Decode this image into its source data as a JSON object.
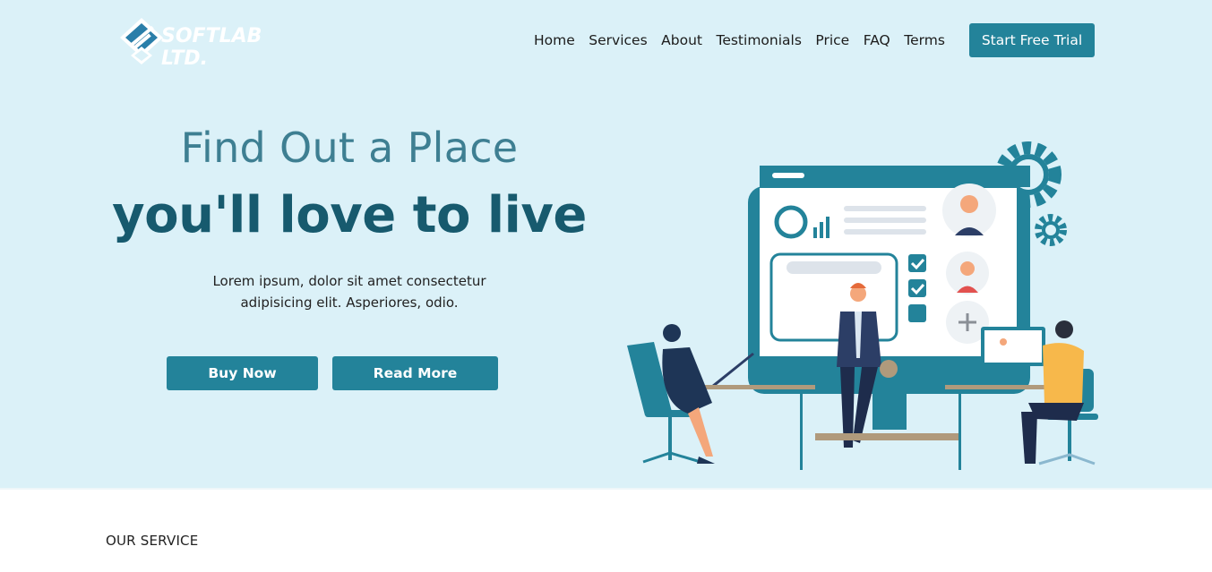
{
  "brand": {
    "name": "SOFTLAB LTD."
  },
  "nav": {
    "items": [
      {
        "label": "Home"
      },
      {
        "label": "Services"
      },
      {
        "label": "About"
      },
      {
        "label": "Testimonials"
      },
      {
        "label": "Price"
      },
      {
        "label": "FAQ"
      },
      {
        "label": "Terms"
      }
    ],
    "cta_label": "Start Free Trial"
  },
  "hero": {
    "headline_line1": "Find Out a Place",
    "headline_line2": "you'll love to live",
    "blurb_line1": "Lorem ipsum, dolor sit amet consectetur",
    "blurb_line2": "adipisicing elit. Asperiores, odio.",
    "buy_label": "Buy Now",
    "more_label": "Read More"
  },
  "section": {
    "label": "OUR SERVICE"
  },
  "colors": {
    "hero_bg": "#dbf1f8",
    "accent": "#23839a",
    "headline_dark": "#175a6e",
    "headline_light": "#3e7f92"
  },
  "illustration": {
    "icon": "office-team-dashboard-illustration"
  }
}
